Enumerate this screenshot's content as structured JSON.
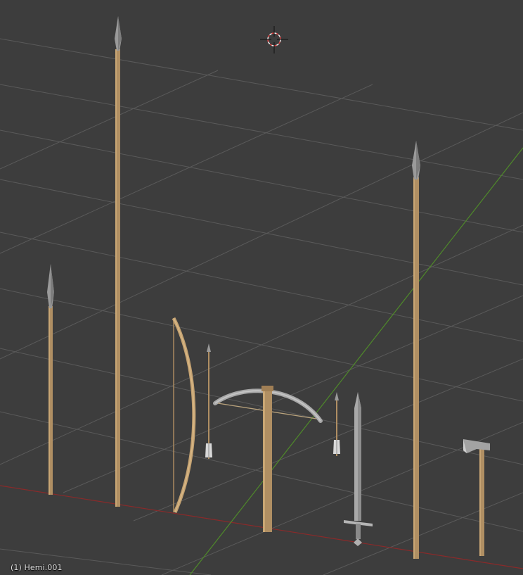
{
  "viewport": {
    "active_object_label": "(1) Hemi.001",
    "colors": {
      "background": "#3d3d3d",
      "grid_line": "#5a5a5a",
      "x_axis": "#8a2a2a",
      "y_axis": "#4f8a2a",
      "wood": "#b08f63",
      "metal": "#9a9a9a",
      "cursor_red": "#e04040",
      "cursor_white": "#f0f0f0"
    }
  },
  "objects": [
    {
      "name": "spear-short",
      "kind": "spear"
    },
    {
      "name": "spear-tall",
      "kind": "spear"
    },
    {
      "name": "longbow",
      "kind": "bow"
    },
    {
      "name": "arrow-1",
      "kind": "arrow"
    },
    {
      "name": "crossbow",
      "kind": "crossbow"
    },
    {
      "name": "arrow-2",
      "kind": "arrow"
    },
    {
      "name": "sword",
      "kind": "sword"
    },
    {
      "name": "spear-right",
      "kind": "spear"
    },
    {
      "name": "axe",
      "kind": "axe"
    }
  ]
}
